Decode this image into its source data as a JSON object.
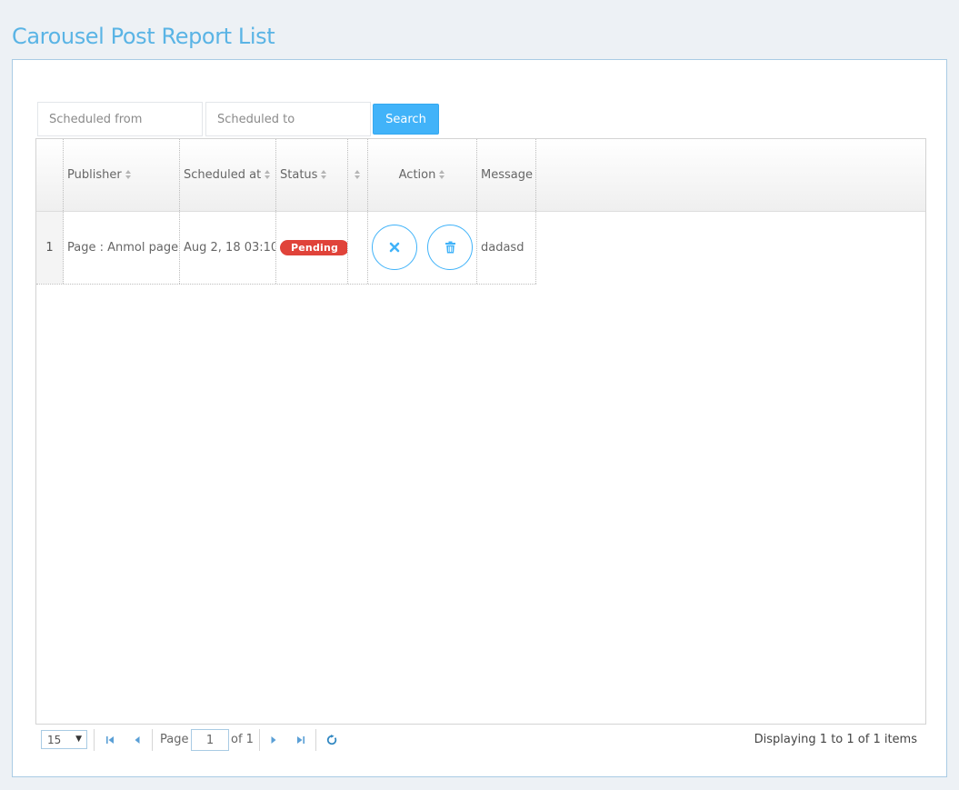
{
  "page": {
    "title": "Carousel Post Report List"
  },
  "filters": {
    "scheduled_from_placeholder": "Scheduled from",
    "scheduled_to_placeholder": "Scheduled to",
    "search_label": "Search"
  },
  "grid": {
    "columns": [
      "",
      "Publisher",
      "Scheduled at",
      "Status",
      "",
      "Action",
      "Message"
    ],
    "rows": [
      {
        "row_number": "1",
        "publisher": "Page : Anmol page",
        "scheduled_at": "Aug 2, 18 03:10",
        "status": "Pending",
        "actions": [
          "close-icon",
          "trash-icon"
        ],
        "message": "dadasd"
      }
    ]
  },
  "pager": {
    "page_size": "15",
    "page_label": "Page",
    "current_page": "1",
    "of_label": "of 1",
    "display_text": "Displaying 1 to 1 of 1 items"
  },
  "colors": {
    "accent": "#41b3f9",
    "title": "#5ab4e5",
    "pending_badge": "#e0433a",
    "background": "#edf1f5"
  }
}
